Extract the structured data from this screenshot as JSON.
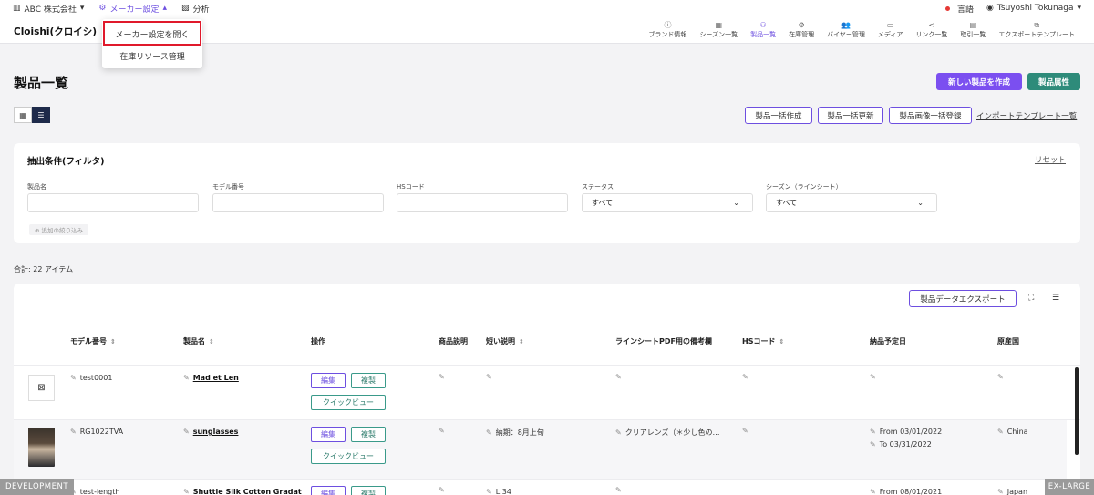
{
  "topbar": {
    "company": "ABC 株式会社",
    "maker_settings": "メーカー設定",
    "analytics": "分析",
    "language": "言語",
    "user": "Tsuyoshi Tokunaga"
  },
  "header": {
    "brand": "Cloishi(クロイシ)",
    "nav": [
      {
        "label": "ブランド情報",
        "icon": "ⓘ"
      },
      {
        "label": "シーズン一覧",
        "icon": "▦"
      },
      {
        "label": "製品一覧",
        "icon": "⚇"
      },
      {
        "label": "在庫管理",
        "icon": "⚙"
      },
      {
        "label": "バイヤー管理",
        "icon": "👥"
      },
      {
        "label": "メディア",
        "icon": "▭"
      },
      {
        "label": "リンク一覧",
        "icon": "<"
      },
      {
        "label": "取引一覧",
        "icon": "▤"
      },
      {
        "label": "エクスポートテンプレート",
        "icon": "⧉"
      }
    ]
  },
  "dropdown": {
    "open_settings": "メーカー設定を開く",
    "inventory": "在庫リソース管理"
  },
  "page": {
    "title": "製品一覧",
    "new_product": "新しい製品を作成",
    "attributes": "製品属性",
    "bulk_create": "製品一括作成",
    "bulk_update": "製品一括更新",
    "bulk_images": "製品画像一括登録",
    "import_templates": "インポートテンプレート一覧"
  },
  "filter": {
    "title": "抽出条件(フィルタ)",
    "reset": "リセット",
    "fields": [
      {
        "label": "製品名",
        "value": ""
      },
      {
        "label": "モデル番号",
        "value": ""
      },
      {
        "label": "HSコード",
        "value": ""
      },
      {
        "label": "ステータス",
        "value": "すべて"
      },
      {
        "label": "シーズン（ラインシート）",
        "value": "すべて"
      }
    ],
    "more": "追加の絞り込み"
  },
  "total": "合計: 22 アイテム",
  "table": {
    "export": "製品データエクスポート",
    "columns": [
      "モデル番号",
      "製品名",
      "操作",
      "商品説明",
      "短い説明",
      "ラインシートPDF用の備考欄",
      "HSコード",
      "納品予定日",
      "原産国"
    ],
    "actions": {
      "edit": "編集",
      "copy": "複製",
      "quick": "クイックビュー"
    },
    "rows": [
      {
        "model": "test0001",
        "name": "Mad et Len",
        "short": "",
        "note": "",
        "date1": "",
        "date2": "",
        "country": ""
      },
      {
        "model": "RG1022TVA",
        "name": "sunglasses",
        "short": "納期：8月上旬",
        "note": "クリアレンズ（＊少し色の…",
        "date1": "From 03/01/2022",
        "date2": "To 03/31/2022",
        "country": "China"
      },
      {
        "model": "test-length",
        "name": "Shuttle Silk Cotton Gradat",
        "short": "L 34",
        "note": "",
        "date1": "From 08/01/2021",
        "date2": "",
        "country": "Japan"
      }
    ]
  },
  "badges": {
    "dev": "DEVELOPMENT",
    "xl": "EX-LARGE"
  },
  "colors": {
    "accent": "#6d4fe0",
    "teal": "#2e8b7a",
    "highlight": "#e0192b"
  }
}
